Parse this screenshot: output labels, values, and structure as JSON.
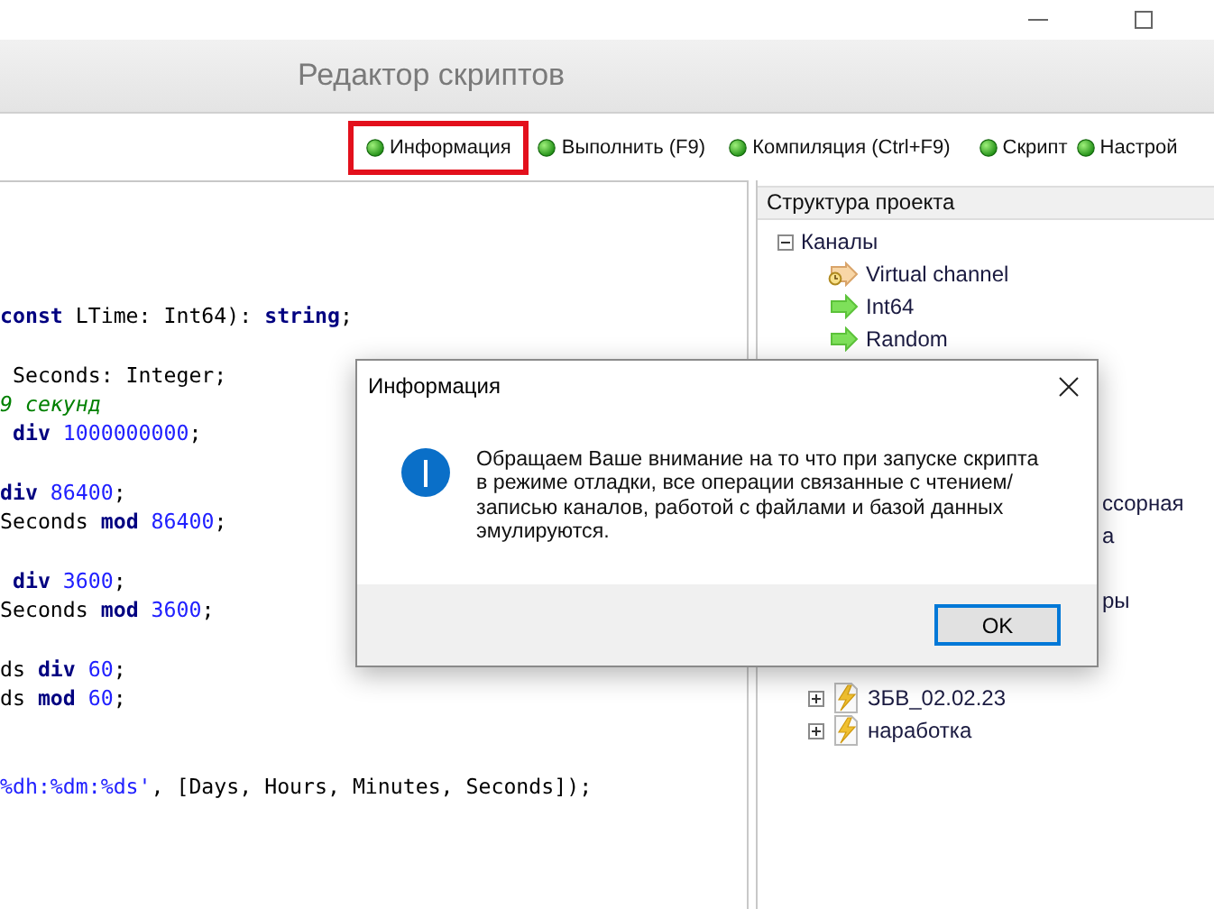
{
  "window": {
    "title": "Редактор скриптов"
  },
  "toolbar": [
    {
      "label": "Информация",
      "highlighted": true
    },
    {
      "label": "Выполнить (F9)",
      "highlighted": false
    },
    {
      "label": "Компиляция (Ctrl+F9)",
      "highlighted": false
    },
    {
      "label": "Скрипт",
      "highlighted": false
    },
    {
      "label": "Настрой",
      "highlighted": false
    }
  ],
  "editor": {
    "lines": [
      {
        "tokens": [
          {
            "kind": "keyword",
            "text": "const"
          },
          {
            "kind": "plain",
            "text": " LTime: Int64): "
          },
          {
            "kind": "keyword",
            "text": "string"
          },
          {
            "kind": "plain",
            "text": ";"
          }
        ]
      },
      {
        "tokens": [
          {
            "kind": "plain",
            "text": " Seconds: Integer;"
          }
        ]
      },
      {
        "tokens": [
          {
            "kind": "comment",
            "text": "9 секунд"
          }
        ]
      },
      {
        "tokens": [
          {
            "kind": "keyword",
            "text": " div"
          },
          {
            "kind": "number",
            "text": " 1000000000"
          },
          {
            "kind": "plain",
            "text": ";"
          }
        ]
      },
      {
        "tokens": [
          {
            "kind": "keyword",
            "text": "div"
          },
          {
            "kind": "number",
            "text": " 86400"
          },
          {
            "kind": "plain",
            "text": ";"
          }
        ]
      },
      {
        "tokens": [
          {
            "kind": "plain",
            "text": "Seconds"
          },
          {
            "kind": "keyword",
            "text": " mod"
          },
          {
            "kind": "number",
            "text": " 86400"
          },
          {
            "kind": "plain",
            "text": ";"
          }
        ]
      },
      {
        "tokens": [
          {
            "kind": "keyword",
            "text": " div"
          },
          {
            "kind": "number",
            "text": " 3600"
          },
          {
            "kind": "plain",
            "text": ";"
          }
        ]
      },
      {
        "tokens": [
          {
            "kind": "plain",
            "text": "Seconds"
          },
          {
            "kind": "keyword",
            "text": " mod"
          },
          {
            "kind": "number",
            "text": " 3600"
          },
          {
            "kind": "plain",
            "text": ";"
          }
        ]
      },
      {
        "tokens": [
          {
            "kind": "plain",
            "text": "ds"
          },
          {
            "kind": "keyword",
            "text": " div"
          },
          {
            "kind": "number",
            "text": " 60"
          },
          {
            "kind": "plain",
            "text": ";"
          }
        ]
      },
      {
        "tokens": [
          {
            "kind": "plain",
            "text": "ds"
          },
          {
            "kind": "keyword",
            "text": " mod"
          },
          {
            "kind": "number",
            "text": " 60"
          },
          {
            "kind": "plain",
            "text": ";"
          }
        ]
      },
      {
        "tokens": [
          {
            "kind": "string",
            "text": "%dh:%dm:%ds'"
          },
          {
            "kind": "plain",
            "text": ", [Days, Hours, Minutes, Seconds]);"
          }
        ]
      }
    ]
  },
  "project_panel": {
    "title": "Структура проекта",
    "root": {
      "label": "Каналы",
      "expanded": true,
      "children": [
        {
          "label": "Virtual channel",
          "kind": "virtual"
        },
        {
          "label": "Int64",
          "kind": "channel"
        },
        {
          "label": "Random",
          "kind": "channel"
        }
      ]
    },
    "fragments": [
      "ссорная",
      "а",
      "ры"
    ],
    "scripts": [
      {
        "label": "ЗБВ_02.02.23",
        "expanded": false
      },
      {
        "label": "наработка",
        "expanded": false
      }
    ]
  },
  "dialog": {
    "title": "Информация",
    "message": "Обращаем Ваше внимание на то что при запуске скрипта в режиме отладки, все операции связанные с чтением/записью каналов, работой с файлами и базой данных эмулируются.",
    "buttons": [
      {
        "label": "OK",
        "focused": true
      }
    ]
  }
}
